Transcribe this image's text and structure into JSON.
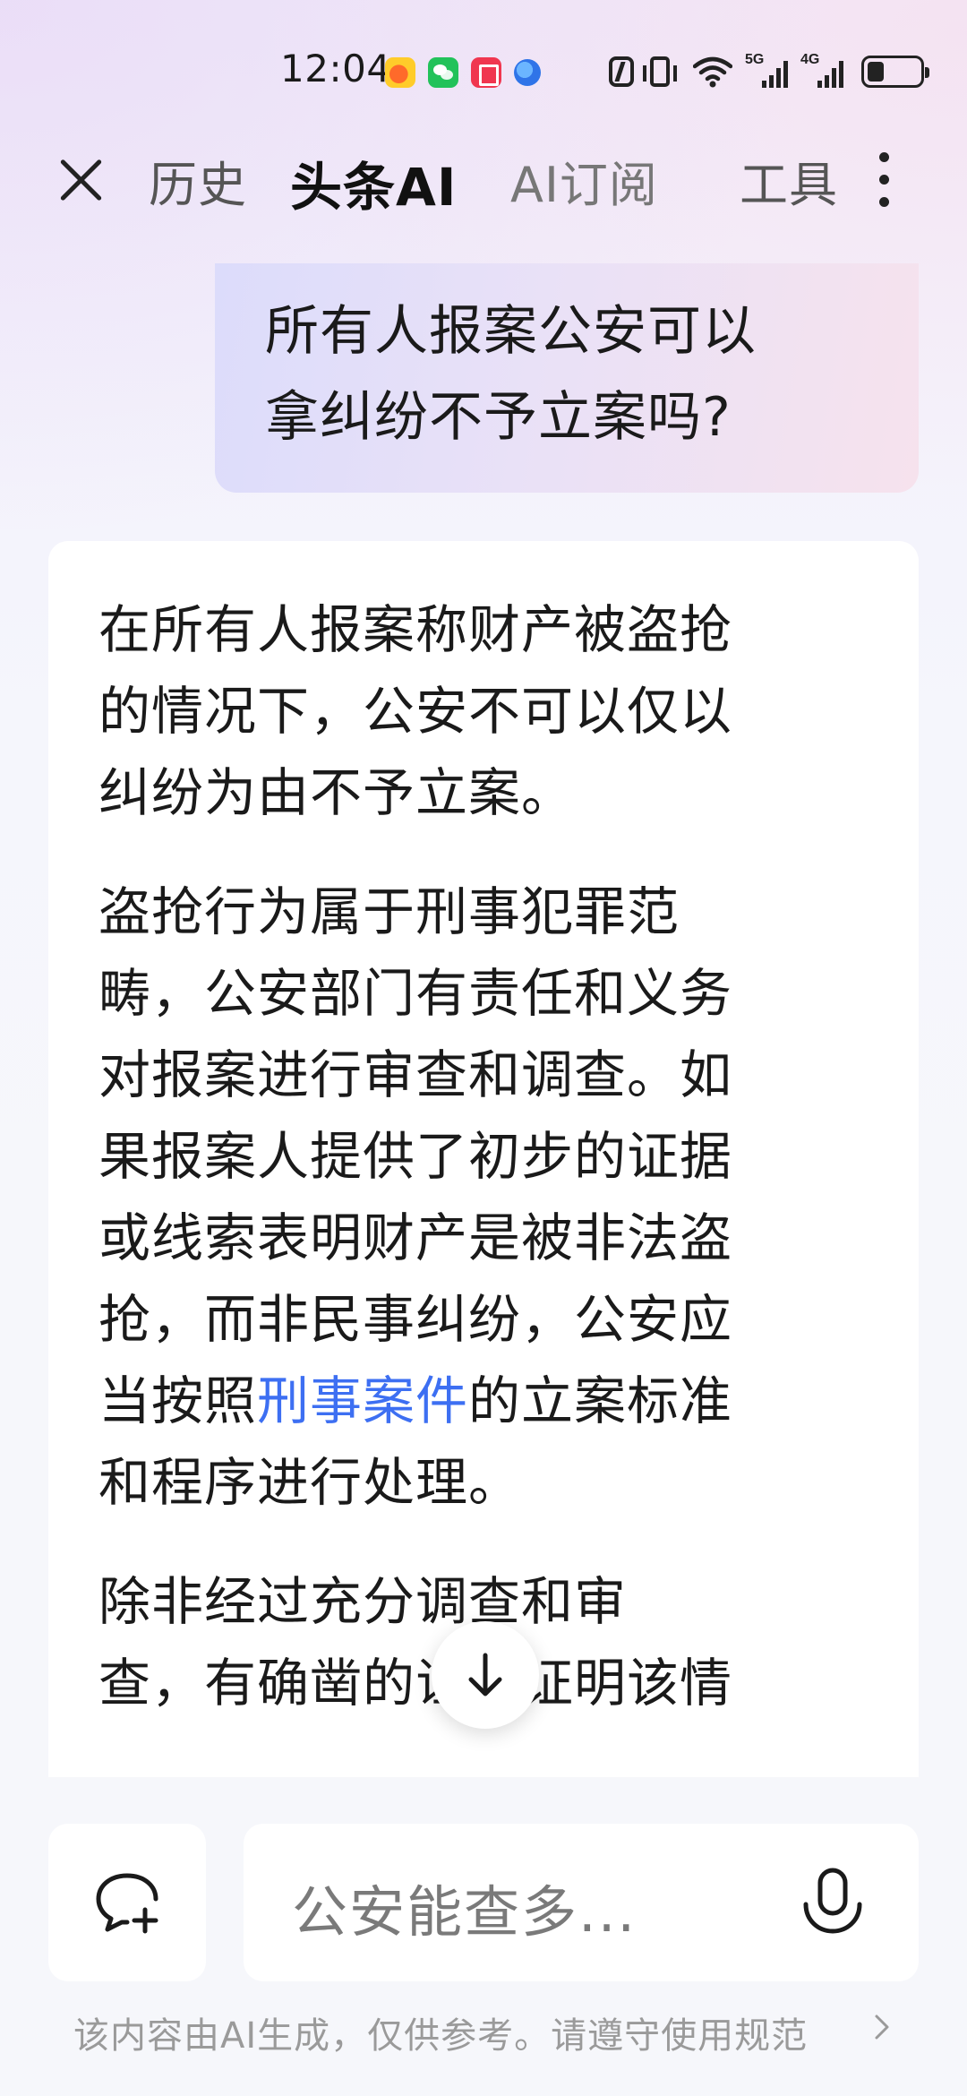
{
  "status_bar": {
    "time": "12:04",
    "app_icons": [
      "weibo-icon",
      "wechat-icon",
      "reader-icon",
      "browser-icon"
    ],
    "system_icons": [
      "nfc-icon",
      "vibrate-icon",
      "wifi-icon",
      "signal-5g-icon",
      "signal-4g-icon",
      "battery-icon"
    ],
    "signal_5g": "5G",
    "signal_4g": "4G"
  },
  "top_nav": {
    "history": "历史",
    "toutiao_ai": "头条AI",
    "ai_subscribe": "AI订阅",
    "tools": "工具"
  },
  "user_message": {
    "line1": "所有人报案公安可以",
    "line2": "拿纠纷不予立案吗?"
  },
  "answer": {
    "para1_line1": "在所有人报案称财产被盗抢",
    "para1_line2": "的情况下，公安不可以仅以",
    "para1_line3": "纠纷为由不予立案。",
    "para2_line1": "盗抢行为属于刑事犯罪范",
    "para2_line2": "畴，公安部门有责任和义务",
    "para2_line3": "对报案进行审查和调查。如",
    "para2_line4": "果报案人提供了初步的证据",
    "para2_line5": "或线索表明财产是被非法盗",
    "para2_line6": "抢，而非民事纠纷，公安应",
    "para2_line7_prefix": "当按照",
    "para2_link": "刑事案件",
    "para2_line7_suffix": "的立案标准",
    "para2_line8": "和程序进行处理。",
    "para3_line1": "除非经过充分调查和审",
    "para3_line2": "查，有确凿的证据证明该情"
  },
  "input": {
    "placeholder": "公安能查多..."
  },
  "disclaimer": "该内容由AI生成，仅供参考。请遵守使用规范",
  "colors": {
    "link": "#3d6ff2",
    "bubble_start": "#dcdcfb",
    "bubble_end": "#f6e2ed",
    "card": "#ffffff"
  }
}
